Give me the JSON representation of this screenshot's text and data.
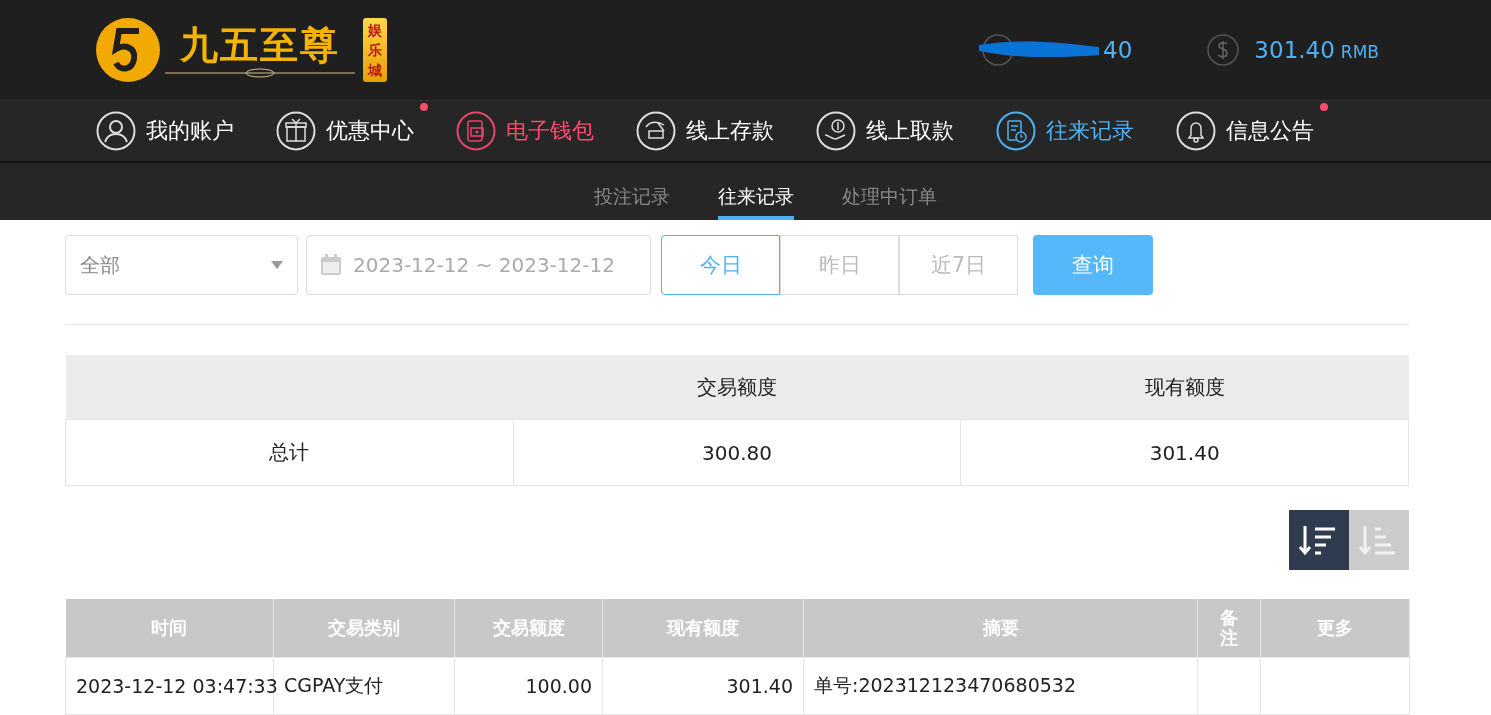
{
  "logo": {
    "name": "九五至尊",
    "badge": "娱乐城"
  },
  "account": {
    "username": "40",
    "balance": "301.40",
    "currency": "RMB"
  },
  "nav": [
    {
      "label": "我的账户",
      "kind": "user",
      "selected": false,
      "dot": false,
      "highlight": false
    },
    {
      "label": "优惠中心",
      "kind": "gift",
      "selected": false,
      "dot": true,
      "highlight": false
    },
    {
      "label": "电子钱包",
      "kind": "wallet",
      "selected": false,
      "dot": false,
      "highlight": true
    },
    {
      "label": "线上存款",
      "kind": "deposit",
      "selected": false,
      "dot": false,
      "highlight": false
    },
    {
      "label": "线上取款",
      "kind": "withdraw",
      "selected": false,
      "dot": false,
      "highlight": false
    },
    {
      "label": "往来记录",
      "kind": "records",
      "selected": true,
      "dot": false,
      "highlight": false
    },
    {
      "label": "信息公告",
      "kind": "bell",
      "selected": false,
      "dot": true,
      "highlight": false
    }
  ],
  "subtabs": [
    {
      "label": "投注记录",
      "selected": false
    },
    {
      "label": "往来记录",
      "selected": true
    },
    {
      "label": "处理中订单",
      "selected": false
    }
  ],
  "filter": {
    "type": "全部",
    "date_range": "2023-12-12 ~ 2023-12-12",
    "ranges": [
      {
        "label": "今日",
        "selected": true
      },
      {
        "label": "昨日",
        "selected": false
      },
      {
        "label": "近7日",
        "selected": false
      }
    ],
    "query": "查询"
  },
  "summary": {
    "columns": [
      "",
      "交易额度",
      "现有额度"
    ],
    "rows": [
      [
        "总计",
        "300.80",
        "301.40"
      ]
    ]
  },
  "sort": [
    {
      "kind": "desc",
      "selected": true
    },
    {
      "kind": "asc",
      "selected": false
    }
  ],
  "table": {
    "columns": [
      "时间",
      "交易类别",
      "交易额度",
      "现有额度",
      "摘要",
      "备注",
      "更多"
    ],
    "rows": [
      [
        "2023-12-12 03:47:33",
        "CGPAY支付",
        "100.00",
        "301.40",
        "单号:202312123470680532",
        "",
        ""
      ]
    ]
  }
}
